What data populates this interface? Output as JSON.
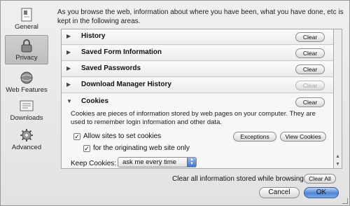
{
  "sidebar": {
    "items": [
      {
        "label": "General",
        "icon": "general-switch-icon"
      },
      {
        "label": "Privacy",
        "icon": "privacy-lock-icon"
      },
      {
        "label": "Web Features",
        "icon": "web-features-globe-icon"
      },
      {
        "label": "Downloads",
        "icon": "downloads-icon"
      },
      {
        "label": "Advanced",
        "icon": "advanced-gear-icon"
      }
    ],
    "selected": "Privacy"
  },
  "intro_text": "As you browse the web, information about where you have been, what you have done, etc is kept in the following areas.",
  "sections": [
    {
      "title": "History",
      "button": "Clear",
      "button_enabled": true
    },
    {
      "title": "Saved Form Information",
      "button": "Clear",
      "button_enabled": true
    },
    {
      "title": "Saved Passwords",
      "button": "Clear",
      "button_enabled": true
    },
    {
      "title": "Download Manager History",
      "button": "Clear",
      "button_enabled": false
    }
  ],
  "cookies": {
    "title": "Cookies",
    "button": "Clear",
    "description": "Cookies are pieces of information stored by web pages on your computer. They are used to remember login information and other data.",
    "allow_label": "Allow sites to set cookies",
    "allow_checked": true,
    "originating_label": "for the originating web site only",
    "originating_checked": true,
    "exceptions_button": "Exceptions",
    "view_cookies_button": "View Cookies",
    "keep_label": "Keep Cookies:",
    "keep_value": "ask me every time"
  },
  "footer": {
    "clear_all_text": "Clear all information stored while browsing:",
    "clear_all_button": "Clear All",
    "cancel_button": "Cancel",
    "ok_button": "OK"
  },
  "colors": {
    "ok_button": "#4f86d6",
    "selected_sidebar": "#c6c6c6"
  }
}
